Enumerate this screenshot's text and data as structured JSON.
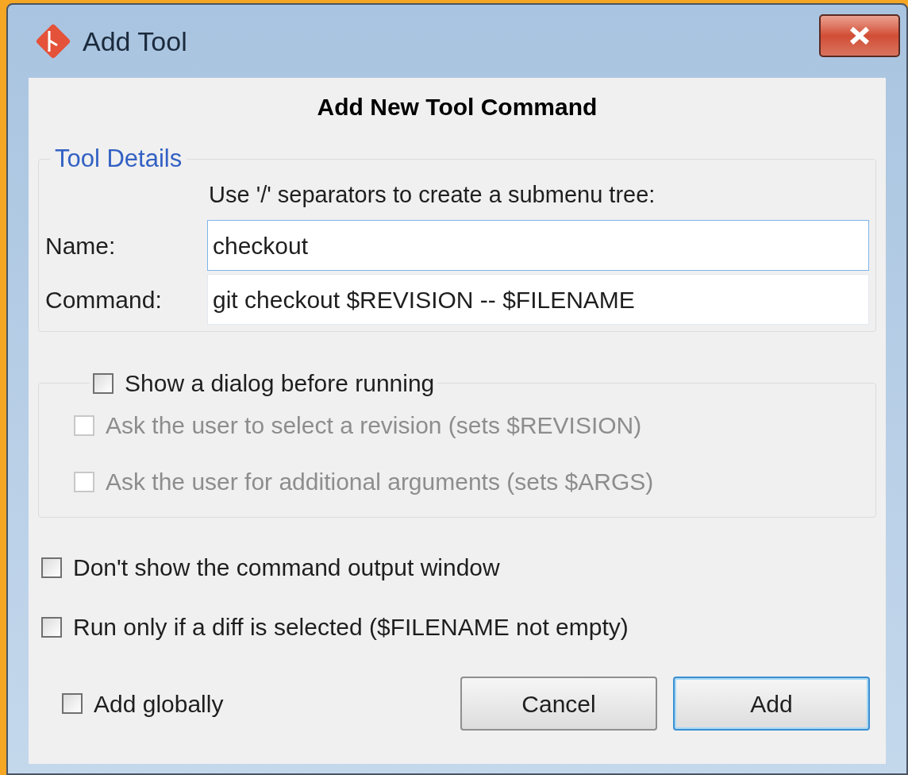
{
  "window": {
    "title": "Add Tool"
  },
  "heading": "Add New Tool Command",
  "tool_details": {
    "legend": "Tool Details",
    "hint": "Use '/' separators to create a submenu tree:",
    "fields": [
      {
        "label": "Name:",
        "value": "checkout",
        "focused": true
      },
      {
        "label": "Command:",
        "value": "git checkout $REVISION -- $FILENAME",
        "focused": false
      }
    ]
  },
  "dialog_option": {
    "label": "Show a dialog before running",
    "checked": false,
    "sub_options": [
      {
        "label": "Ask the user to select a revision (sets $REVISION)",
        "checked": false,
        "disabled": true
      },
      {
        "label": "Ask the user for additional arguments (sets $ARGS)",
        "checked": false,
        "disabled": true
      }
    ]
  },
  "options": [
    {
      "label": "Don't show the command output window",
      "checked": false
    },
    {
      "label": "Run only if a diff is selected ($FILENAME not empty)",
      "checked": false
    }
  ],
  "add_globally": {
    "label": "Add globally",
    "checked": false
  },
  "buttons": [
    {
      "label": "Cancel",
      "default": false
    },
    {
      "label": "Add",
      "default": true
    }
  ]
}
